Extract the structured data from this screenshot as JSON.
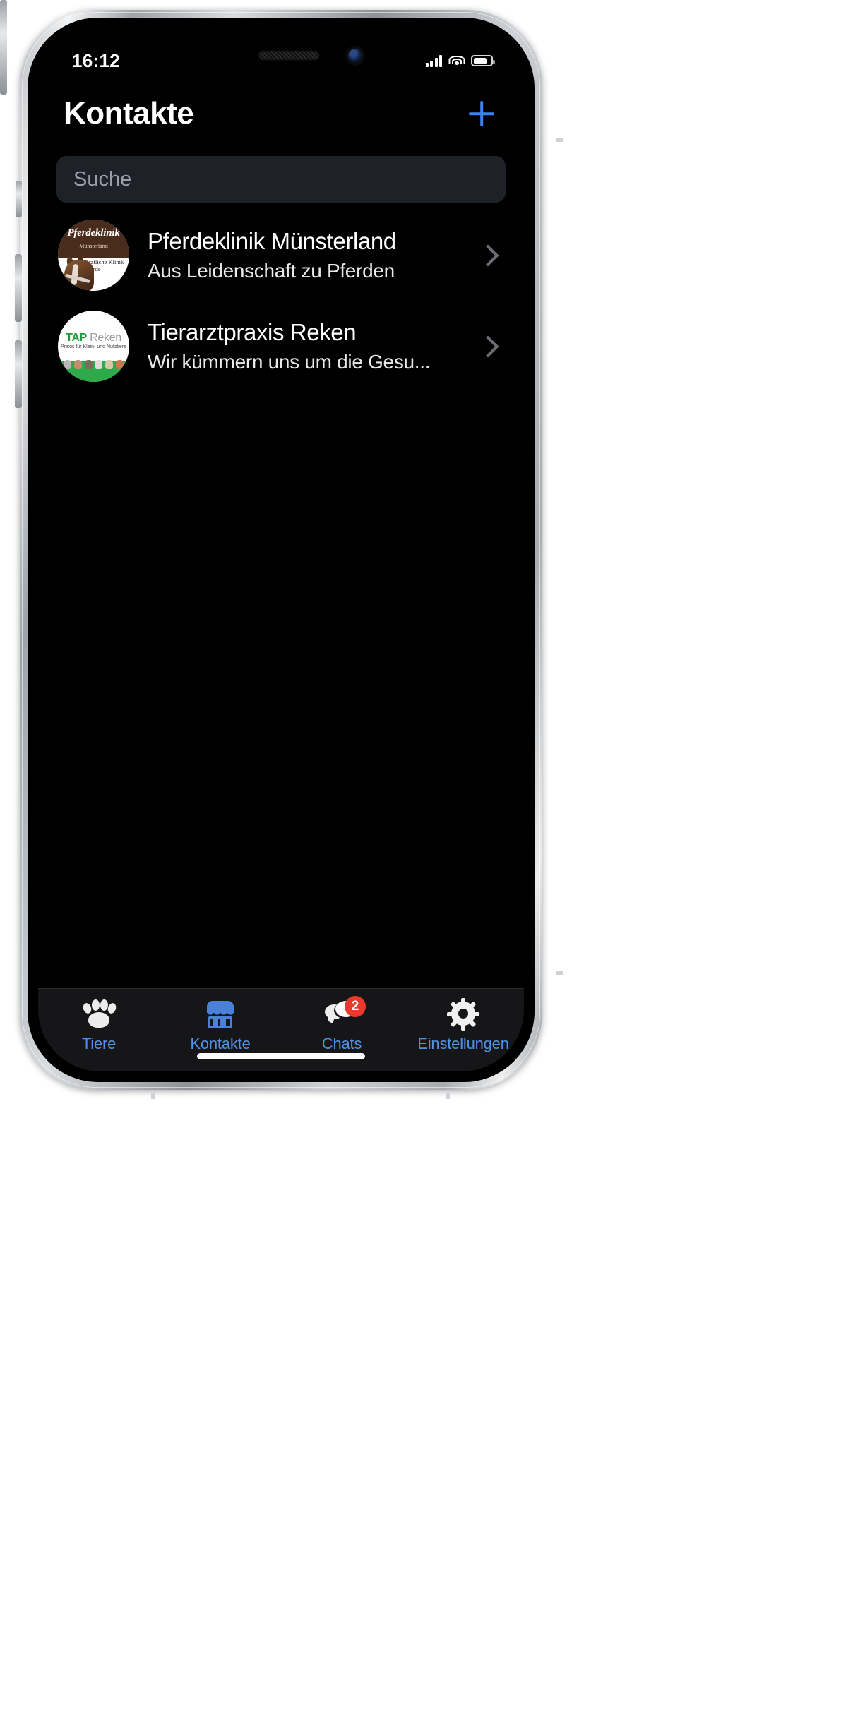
{
  "status_bar": {
    "time": "16:12",
    "cellular_icon": "cellular-bars-icon",
    "wifi_icon": "wifi-icon",
    "battery_icon": "battery-icon"
  },
  "nav": {
    "title": "Kontakte",
    "add_icon": "plus-icon"
  },
  "search": {
    "placeholder": "Suche",
    "value": ""
  },
  "contacts": [
    {
      "name": "Pferdeklinik Münsterland",
      "subtitle": "Aus Leidenschaft zu Pferden",
      "avatar": {
        "type": "horse-clinic-logo",
        "line1": "Pferdeklinik",
        "line2": "Münsterland",
        "line3": "Tierärztliche Klinik für Pferde",
        "top_color": "#4a2c1d",
        "bottom_color": "#ffffff"
      },
      "chevron_icon": "chevron-right-icon"
    },
    {
      "name": "Tierarztpraxis Reken",
      "subtitle": "Wir kümmern uns um die Gesu...",
      "avatar": {
        "type": "tap-reken-logo",
        "line1_bold": "TAP",
        "line1_rest": " Reken",
        "line2": "Praxis für Klein- und Nutztiere",
        "accent_color": "#2faa4a",
        "background": "#ffffff"
      },
      "chevron_icon": "chevron-right-icon"
    }
  ],
  "tab_bar": {
    "active": "Kontakte",
    "active_color": "#4f93e8",
    "badge_color": "#e8392c",
    "tabs": [
      {
        "label": "Tiere",
        "icon": "paw-icon",
        "badge": ""
      },
      {
        "label": "Kontakte",
        "icon": "storefront-icon",
        "badge": ""
      },
      {
        "label": "Chats",
        "icon": "chat-bubbles-icon",
        "badge": "2"
      },
      {
        "label": "Einstellungen",
        "icon": "gear-icon",
        "badge": ""
      }
    ]
  }
}
